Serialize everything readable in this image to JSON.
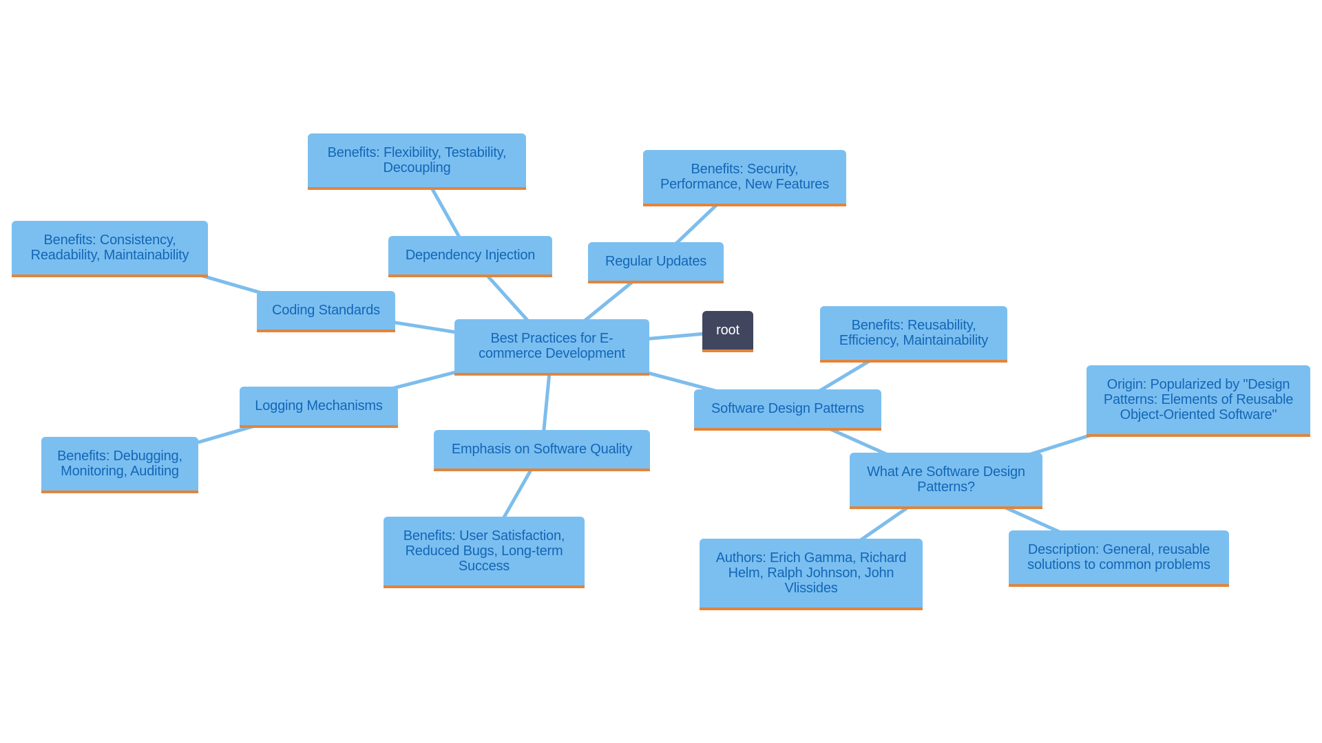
{
  "diagram": {
    "title": "Best Practices for E-commerce Development",
    "colors": {
      "node_fill": "#7bbff1",
      "node_text": "#1366b5",
      "node_accent": "#e2843a",
      "edge": "#7dbdec",
      "root_fill": "#40465e",
      "root_text": "#ffffff"
    },
    "nodes": {
      "root": "root",
      "center": "Best Practices for E-commerce Development",
      "dependency_injection": "Dependency Injection",
      "di_benefits": "Benefits: Flexibility, Testability, Decoupling",
      "regular_updates": "Regular Updates",
      "updates_benefits": "Benefits: Security, Performance, New Features",
      "coding_standards": "Coding Standards",
      "coding_benefits": "Benefits: Consistency, Readability, Maintainability",
      "logging": "Logging Mechanisms",
      "logging_benefits": "Benefits: Debugging, Monitoring, Auditing",
      "software_quality": "Emphasis on Software Quality",
      "quality_benefits": "Benefits: User Satisfaction, Reduced Bugs, Long-term Success",
      "design_patterns": "Software Design Patterns",
      "patterns_benefits": "Benefits: Reusability, Efficiency, Maintainability",
      "what_are_patterns": "What Are Software Design Patterns?",
      "origin": "Origin: Popularized by \"Design Patterns: Elements of Reusable Object-Oriented Software\"",
      "authors": "Authors: Erich Gamma, Richard Helm, Ralph Johnson, John Vlissides",
      "description": "Description: General, reusable solutions to common problems"
    },
    "edges": [
      [
        "center",
        "root"
      ],
      [
        "center",
        "dependency_injection"
      ],
      [
        "dependency_injection",
        "di_benefits"
      ],
      [
        "center",
        "regular_updates"
      ],
      [
        "regular_updates",
        "updates_benefits"
      ],
      [
        "center",
        "coding_standards"
      ],
      [
        "coding_standards",
        "coding_benefits"
      ],
      [
        "center",
        "logging"
      ],
      [
        "logging",
        "logging_benefits"
      ],
      [
        "center",
        "software_quality"
      ],
      [
        "software_quality",
        "quality_benefits"
      ],
      [
        "center",
        "design_patterns"
      ],
      [
        "design_patterns",
        "patterns_benefits"
      ],
      [
        "design_patterns",
        "what_are_patterns"
      ],
      [
        "what_are_patterns",
        "origin"
      ],
      [
        "what_are_patterns",
        "authors"
      ],
      [
        "what_are_patterns",
        "description"
      ]
    ]
  }
}
